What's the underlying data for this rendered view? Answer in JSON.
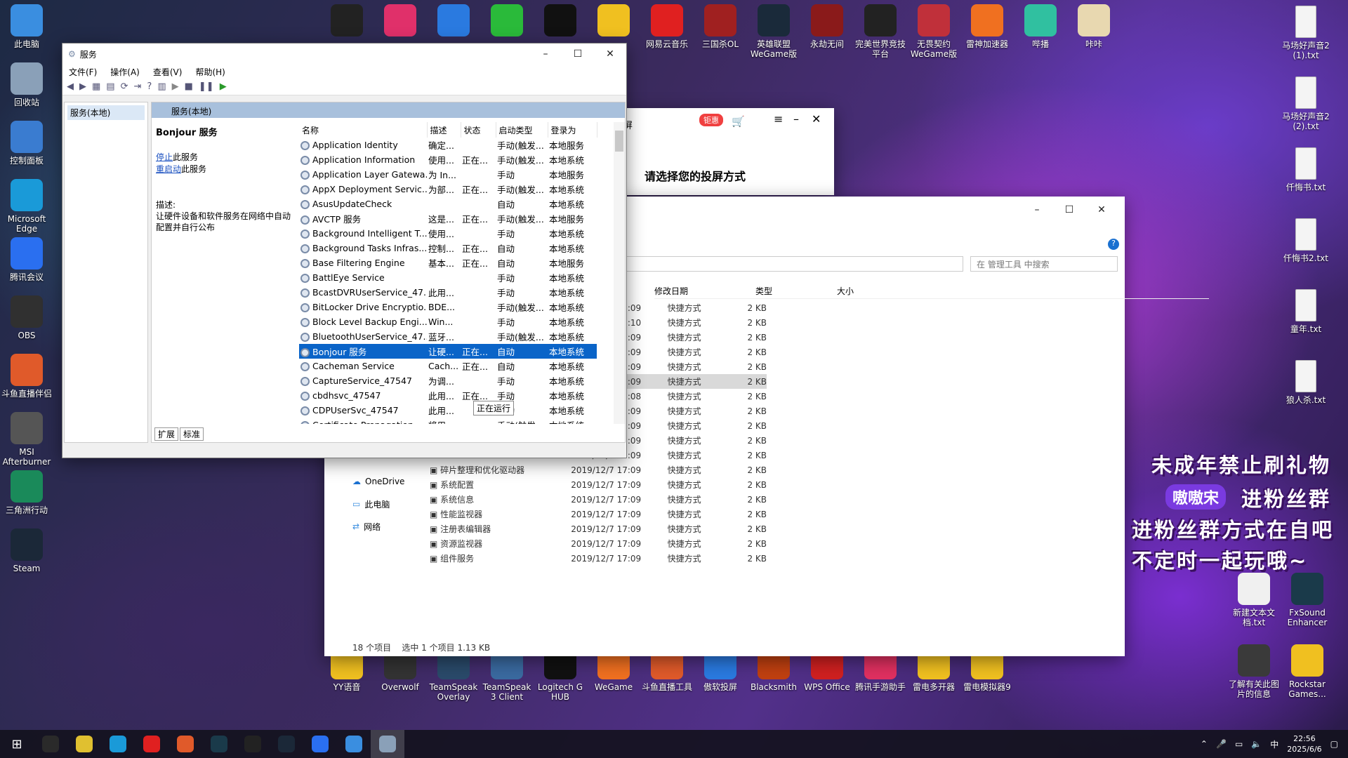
{
  "desktop_left": [
    {
      "label": "此电脑",
      "color": "#3a8ee0"
    },
    {
      "label": "回收站",
      "color": "#8aa0b8"
    },
    {
      "label": "控制面板",
      "color": "#3a7cd0"
    },
    {
      "label": "Microsoft Edge",
      "color": "#1a9ad8"
    },
    {
      "label": "腾讯会议",
      "color": "#2a6ff0"
    },
    {
      "label": "OBS",
      "color": "#303030"
    },
    {
      "label": "斗鱼直播伴侣",
      "color": "#e05a2a"
    },
    {
      "label": "MSI Afterburner",
      "color": "#555"
    },
    {
      "label": "三角洲行动",
      "color": "#1a8a5a"
    },
    {
      "label": "Steam",
      "color": "#1b2838"
    }
  ],
  "desktop_top": [
    {
      "label": "",
      "color": "#222"
    },
    {
      "label": "",
      "color": "#e0306a"
    },
    {
      "label": "",
      "color": "#2a7ae0"
    },
    {
      "label": "",
      "color": "#2aba3a"
    },
    {
      "label": "",
      "color": "#111"
    },
    {
      "label": "",
      "color": "#f0c020"
    },
    {
      "label": "网易云音乐",
      "color": "#e02020"
    },
    {
      "label": "三国杀OL",
      "color": "#a02020"
    },
    {
      "label": "英雄联盟 WeGame版",
      "color": "#1a2a3a"
    },
    {
      "label": "永劫无间",
      "color": "#8a1a1a"
    },
    {
      "label": "完美世界竞技平台",
      "color": "#222"
    },
    {
      "label": "无畏契约 WeGame版",
      "color": "#c0303a"
    },
    {
      "label": "雷神加速器",
      "color": "#f07020"
    },
    {
      "label": "哔播",
      "color": "#30c0a0"
    },
    {
      "label": "咔咔",
      "color": "#e8d8b0"
    }
  ],
  "desktop_right": [
    {
      "label": "马场好声音2 (1).txt"
    },
    {
      "label": "马场好声音2 (2).txt"
    },
    {
      "label": "仟悔书.txt"
    },
    {
      "label": "仟悔书2.txt"
    },
    {
      "label": "童年.txt"
    },
    {
      "label": "狼人杀.txt"
    }
  ],
  "desktop_right_lower": [
    {
      "label": "新建文本文档.txt",
      "color": "#f0f0f0"
    },
    {
      "label": "FxSound Enhancer",
      "color": "#1a3a4a"
    },
    {
      "label": "了解有关此图片的信息",
      "color": "#3a3a3a"
    },
    {
      "label": "Rockstar Games...",
      "color": "#f0c020"
    }
  ],
  "desktop_bottom": [
    {
      "label": "YY语音",
      "color": "#f0c020"
    },
    {
      "label": "Overwolf",
      "color": "#333"
    },
    {
      "label": "TeamSpeak Overlay",
      "color": "#2a4a6a"
    },
    {
      "label": "TeamSpeak 3 Client",
      "color": "#3a6aa0"
    },
    {
      "label": "Logitech G HUB",
      "color": "#111"
    },
    {
      "label": "WeGame",
      "color": "#f07020"
    },
    {
      "label": "斗鱼直播工具",
      "color": "#e05a2a"
    },
    {
      "label": "傲软投屏",
      "color": "#2a7ae0"
    },
    {
      "label": "Blacksmith",
      "color": "#c04010"
    },
    {
      "label": "WPS Office",
      "color": "#d02020"
    },
    {
      "label": "腾讯手游助手",
      "color": "#e03060"
    },
    {
      "label": "雷电多开器",
      "color": "#f0c020"
    },
    {
      "label": "雷电模拟器9",
      "color": "#f0c020"
    }
  ],
  "promo": {
    "l1": "未成年禁止刷礼物",
    "l2": "嗷嗷宋",
    "l3": "进粉丝群",
    "l4": "进粉丝群方式在自吧",
    "l5": "不定时一起玩哦~"
  },
  "services": {
    "title": "服务",
    "menu": [
      "文件(F)",
      "操作(A)",
      "查看(V)",
      "帮助(H)"
    ],
    "tree_item": "服务(本地)",
    "header": "服务(本地)",
    "selected_name": "Bonjour 服务",
    "stop_link": "停止",
    "stop_rest": "此服务",
    "restart_link": "重启动",
    "restart_rest": "此服务",
    "desc_label": "描述:",
    "desc_text": "让硬件设备和软件服务在网络中自动配置并自行公布",
    "columns": [
      "名称",
      "描述",
      "状态",
      "启动类型",
      "登录为"
    ],
    "rows": [
      [
        "Application Identity",
        "确定...",
        "",
        "手动(触发...",
        "本地服务"
      ],
      [
        "Application Information",
        "使用...",
        "正在...",
        "手动(触发...",
        "本地系统"
      ],
      [
        "Application Layer Gatewa...",
        "为 In...",
        "",
        "手动",
        "本地服务"
      ],
      [
        "AppX Deployment Servic...",
        "为部...",
        "正在...",
        "手动(触发...",
        "本地系统"
      ],
      [
        "AsusUpdateCheck",
        "",
        "",
        "自动",
        "本地系统"
      ],
      [
        "AVCTP 服务",
        "这是...",
        "正在...",
        "手动(触发...",
        "本地服务"
      ],
      [
        "Background Intelligent T...",
        "使用...",
        "",
        "手动",
        "本地系统"
      ],
      [
        "Background Tasks Infras...",
        "控制...",
        "正在...",
        "自动",
        "本地系统"
      ],
      [
        "Base Filtering Engine",
        "基本...",
        "正在...",
        "自动",
        "本地服务"
      ],
      [
        "BattlEye Service",
        "",
        "",
        "手动",
        "本地系统"
      ],
      [
        "BcastDVRUserService_47...",
        "此用...",
        "",
        "手动",
        "本地系统"
      ],
      [
        "BitLocker Drive Encryptio...",
        "BDE...",
        "",
        "手动(触发...",
        "本地系统"
      ],
      [
        "Block Level Backup Engi...",
        "Win...",
        "",
        "手动",
        "本地系统"
      ],
      [
        "BluetoothUserService_47...",
        "蓝牙...",
        "",
        "手动(触发...",
        "本地系统"
      ],
      [
        "Bonjour 服务",
        "让硬...",
        "正在...",
        "自动",
        "本地系统"
      ],
      [
        "Cacheman Service",
        "Cach...",
        "正在...",
        "自动",
        "本地系统"
      ],
      [
        "CaptureService_47547",
        "为调...",
        "",
        "手动",
        "本地系统"
      ],
      [
        "cbdhsvc_47547",
        "此用...",
        "正在...",
        "手动",
        "本地系统"
      ],
      [
        "CDPUserSvc_47547",
        "此用...",
        "",
        "自动",
        "本地系统"
      ],
      [
        "Certificate Propagation",
        "将用...",
        "",
        "手动(触发...",
        "本地系统"
      ]
    ],
    "selected_index": 14,
    "tooltip": "正在运行",
    "tabs": [
      "扩展",
      "标准"
    ]
  },
  "cast": {
    "badge": "钜惠",
    "heading": "请选择您的投屏方式",
    "glyph": "屏"
  },
  "explorer": {
    "search_placeholder": "在 管理工具 中搜索",
    "cols": [
      "修改日期",
      "类型",
      "大小"
    ],
    "rows": [
      [
        "",
        "2019/12/7 17:09",
        "快捷方式",
        "2 KB"
      ],
      [
        "",
        "2019/12/7 17:10",
        "快捷方式",
        "2 KB"
      ],
      [
        "",
        "2019/12/7 17:09",
        "快捷方式",
        "2 KB"
      ],
      [
        "",
        "2019/12/7 17:09",
        "快捷方式",
        "2 KB"
      ],
      [
        "",
        "2019/12/7 17:09",
        "快捷方式",
        "2 KB"
      ],
      [
        "",
        "2019/12/7 17:09",
        "快捷方式",
        "2 KB"
      ],
      [
        "",
        "2019/12/7 17:08",
        "快捷方式",
        "2 KB"
      ],
      [
        "",
        "2019/12/7 17:09",
        "快捷方式",
        "2 KB"
      ],
      [
        "",
        "2019/12/7 17:09",
        "快捷方式",
        "2 KB"
      ],
      [
        "",
        "2019/12/7 17:09",
        "快捷方式",
        "2 KB"
      ],
      [
        "",
        "2019/12/7 17:09",
        "快捷方式",
        "2 KB"
      ],
      [
        "碎片整理和优化驱动器",
        "2019/12/7 17:09",
        "快捷方式",
        "2 KB"
      ],
      [
        "系统配置",
        "2019/12/7 17:09",
        "快捷方式",
        "2 KB"
      ],
      [
        "系统信息",
        "2019/12/7 17:09",
        "快捷方式",
        "2 KB"
      ],
      [
        "性能监视器",
        "2019/12/7 17:09",
        "快捷方式",
        "2 KB"
      ],
      [
        "注册表编辑器",
        "2019/12/7 17:09",
        "快捷方式",
        "2 KB"
      ],
      [
        "资源监视器",
        "2019/12/7 17:09",
        "快捷方式",
        "2 KB"
      ],
      [
        "组件服务",
        "2019/12/7 17:09",
        "快捷方式",
        "2 KB"
      ]
    ],
    "highlight_index": 5,
    "nav": [
      "OneDrive",
      "此电脑",
      "网络"
    ],
    "status": "18 个项目",
    "status2": "选中 1 个项目  1.13 KB"
  },
  "taskbar": {
    "time": "22:56",
    "date": "2025/6/6",
    "ime": "中",
    "apps": [
      "#2a2a2a",
      "#e0c030",
      "#1a9ad8",
      "#e02020",
      "#e05a2a",
      "#1a3a4a",
      "#222",
      "#1b2838",
      "#2a6ff0",
      "#3a8ee0",
      "#8aa0b8"
    ]
  }
}
